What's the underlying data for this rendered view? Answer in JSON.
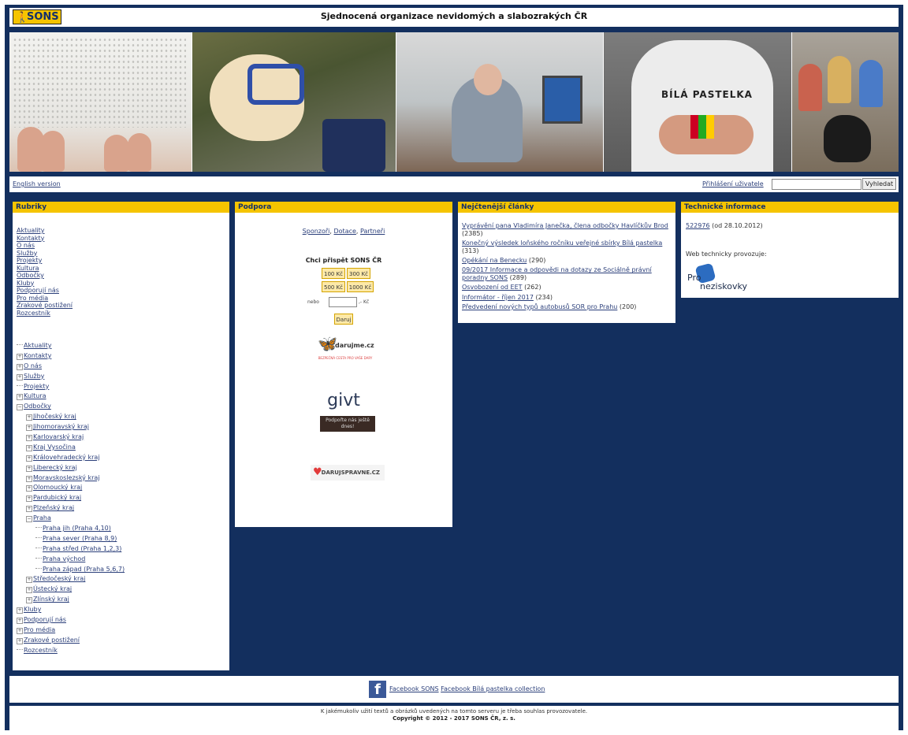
{
  "header": {
    "logo_text": "SONS",
    "title": "Sjednocená organizace nevidomých a slabozrakých ČR"
  },
  "banner": {
    "shirt_text": "BÍLÁ PASTELKA"
  },
  "topbar": {
    "english": "English version",
    "login": "Přihlášení uživatele",
    "search_value": "",
    "search_button": "Vyhledat"
  },
  "rubriky": {
    "heading": "Rubriky",
    "links": [
      "Aktuality",
      "Kontakty",
      "O nás",
      "Služby",
      "Projekty",
      "Kultura",
      "Odbočky",
      "Kluby",
      "Podporují nás",
      "Pro média",
      "Zrakové postižení",
      "Rozcestník"
    ],
    "tree": [
      {
        "label": "Aktuality",
        "level": 0,
        "icon": "leaf"
      },
      {
        "label": "Kontakty",
        "level": 0,
        "icon": "plus"
      },
      {
        "label": "O nás",
        "level": 0,
        "icon": "plus"
      },
      {
        "label": "Služby",
        "level": 0,
        "icon": "plus"
      },
      {
        "label": "Projekty",
        "level": 0,
        "icon": "leaf"
      },
      {
        "label": "Kultura",
        "level": 0,
        "icon": "plus"
      },
      {
        "label": "Odbočky",
        "level": 0,
        "icon": "minus"
      },
      {
        "label": "Jihočeský kraj",
        "level": 1,
        "icon": "plus"
      },
      {
        "label": "Jihomoravský kraj",
        "level": 1,
        "icon": "plus"
      },
      {
        "label": "Karlovarský kraj",
        "level": 1,
        "icon": "plus"
      },
      {
        "label": "Kraj Vysočina",
        "level": 1,
        "icon": "plus"
      },
      {
        "label": "Královehradecký kraj",
        "level": 1,
        "icon": "plus"
      },
      {
        "label": "Liberecký kraj",
        "level": 1,
        "icon": "plus"
      },
      {
        "label": "Moravskoslezský kraj",
        "level": 1,
        "icon": "plus"
      },
      {
        "label": "Olomoucký kraj",
        "level": 1,
        "icon": "plus"
      },
      {
        "label": "Pardubický kraj",
        "level": 1,
        "icon": "plus"
      },
      {
        "label": "Plzeňský kraj",
        "level": 1,
        "icon": "plus"
      },
      {
        "label": "Praha",
        "level": 1,
        "icon": "minus"
      },
      {
        "label": "Praha jih (Praha 4,10)",
        "level": 2,
        "icon": "leaf"
      },
      {
        "label": "Praha sever (Praha 8,9)",
        "level": 2,
        "icon": "leaf"
      },
      {
        "label": "Praha střed (Praha 1,2,3)",
        "level": 2,
        "icon": "leaf"
      },
      {
        "label": "Praha východ",
        "level": 2,
        "icon": "leaf"
      },
      {
        "label": "Praha západ (Praha 5,6,7)",
        "level": 2,
        "icon": "leaf"
      },
      {
        "label": "Středočeský kraj",
        "level": 1,
        "icon": "plus"
      },
      {
        "label": "Ústecký kraj",
        "level": 1,
        "icon": "plus"
      },
      {
        "label": "Zlínský kraj",
        "level": 1,
        "icon": "plus"
      },
      {
        "label": "Kluby",
        "level": 0,
        "icon": "plus"
      },
      {
        "label": "Podporují nás",
        "level": 0,
        "icon": "plus"
      },
      {
        "label": "Pro média",
        "level": 0,
        "icon": "plus"
      },
      {
        "label": "Zrakové postižení",
        "level": 0,
        "icon": "plus"
      },
      {
        "label": "Rozcestník",
        "level": 0,
        "icon": "leaf"
      }
    ]
  },
  "podpora": {
    "heading": "Podpora",
    "link1": "Sponzoři",
    "link2": "Dotace",
    "link3": "Partneři",
    "sep1": ", ",
    "sep2": ", ",
    "chci": "Chci přispět SONS ČR",
    "amounts": [
      "100 Kč",
      "300 Kč",
      "500 Kč",
      "1000 Kč"
    ],
    "nebo": "nebo",
    "kc": ",- Kč",
    "daruj": "Daruj",
    "darujme": "darujme.cz",
    "darujme_sub": "BEZPEČNÁ CESTA PRO VAŠE DARY",
    "givt": "givt",
    "givt_btn": "Podpořte nás ještě dnes!",
    "darujspravne": "DARUJSPRAVNE.CZ"
  },
  "nejctenejsi": {
    "heading": "Nejčtenější články",
    "items": [
      {
        "title": "Vyprávění pana Vladimíra Janečka, člena odbočky Havlíčkův Brod",
        "count": "(2385)"
      },
      {
        "title": "Konečný výsledek loňského ročníku veřejné sbírky Bílá pastelka",
        "count": "(313)"
      },
      {
        "title": "Opékání na Benecku",
        "count": "(290)"
      },
      {
        "title": "09/2017 Informace a odpovědi na dotazy ze Sociálně právní poradny SONS",
        "count": "(289)"
      },
      {
        "title": "Osvobození od EET",
        "count": "(262)"
      },
      {
        "title": "Informátor - říjen 2017",
        "count": "(234)"
      },
      {
        "title": "Předvedení nových typů autobusů SOR pro Prahu",
        "count": "(200)"
      }
    ]
  },
  "technicke": {
    "heading": "Technické informace",
    "counter": "522976",
    "since": " (od 28.10.2012)",
    "provozuje": "Web technicky provozuje:",
    "pro": "Pro",
    "neziskovky": "neziskovky"
  },
  "footer": {
    "fb1": "Facebook SONS",
    "fb2": "Facebook Bílá pastelka collection",
    "notice": "K jakémukoliv užití textů a obrázků uvedených na tomto serveru je třeba souhlas provozovatele.",
    "copyright": "Copyright © 2012 - 2017 SONS ČR, z. s."
  },
  "colors": {
    "navy": "#132f5e",
    "yellow": "#f5c400",
    "link": "#2b3f7a"
  }
}
